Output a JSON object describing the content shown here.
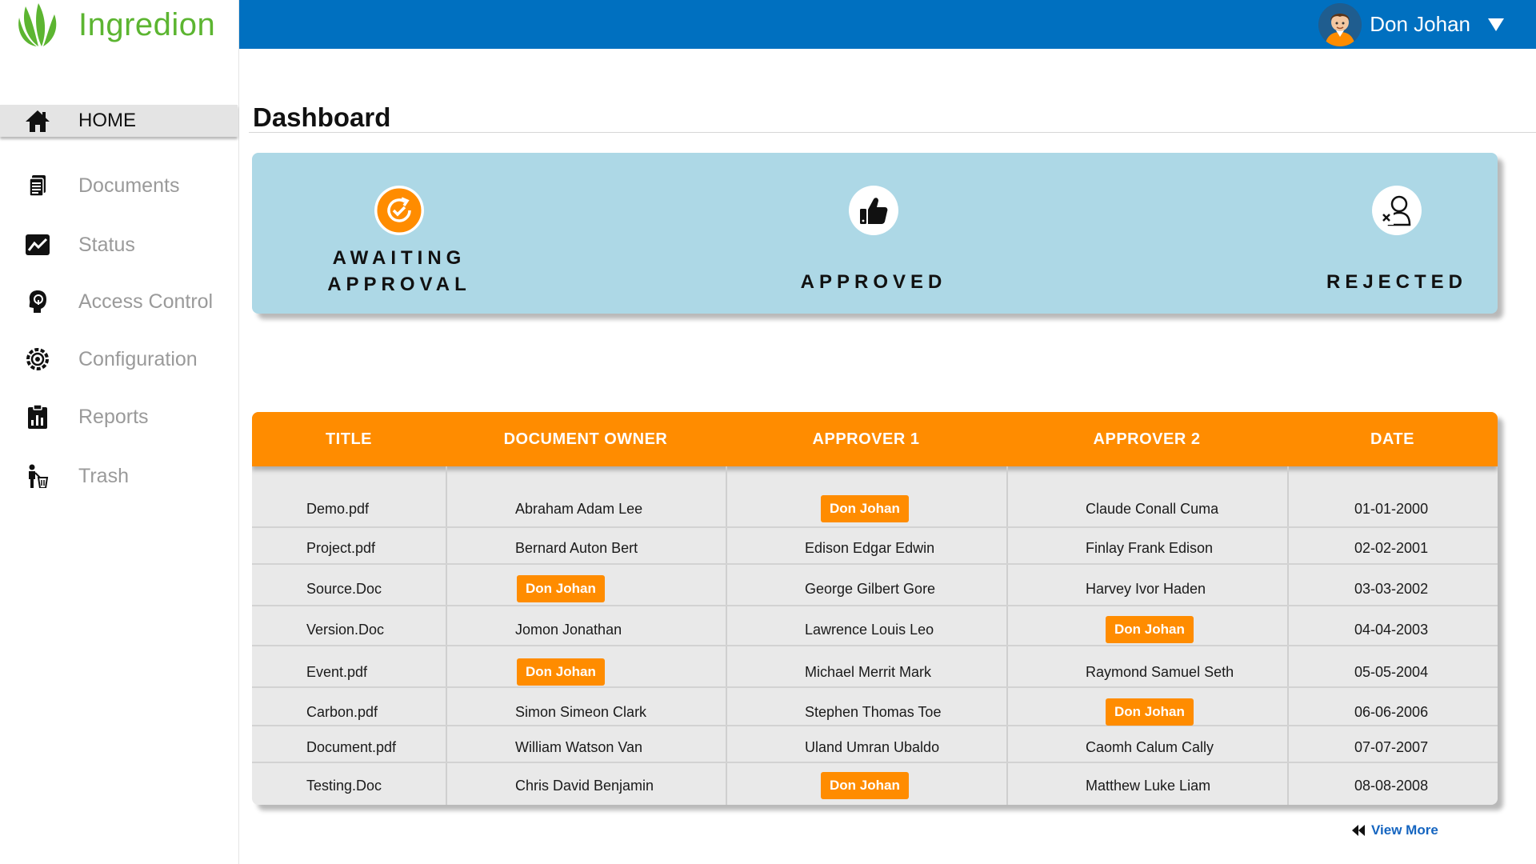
{
  "brand": {
    "name": "Ingredion",
    "color": "#5cb531"
  },
  "sidebar": {
    "items": [
      {
        "label": "HOME",
        "icon": "home-icon",
        "active": true
      },
      {
        "label": "Documents",
        "icon": "documents-icon",
        "active": false
      },
      {
        "label": "Status",
        "icon": "status-chart-icon",
        "active": false
      },
      {
        "label": "Access Control",
        "icon": "access-control-icon",
        "active": false
      },
      {
        "label": "Configuration",
        "icon": "configuration-gear-icon",
        "active": false
      },
      {
        "label": "Reports",
        "icon": "reports-icon",
        "active": false
      },
      {
        "label": "Trash",
        "icon": "trash-icon",
        "active": false
      }
    ]
  },
  "header": {
    "user_name": "Don Johan",
    "bar_color": "#0070c0"
  },
  "page": {
    "title": "Dashboard"
  },
  "status_panel": {
    "awaiting": "AWAITING\nAPPROVAL",
    "approved": "APPROVED",
    "rejected": "REJECTED",
    "background": "#add8e6",
    "accent": "#ff8c00"
  },
  "table": {
    "columns": [
      "TITLE",
      "DOCUMENT OWNER",
      "APPROVER 1",
      "APPROVER 2",
      "DATE"
    ],
    "rows": [
      [
        "Demo.pdf",
        "Abraham Adam Lee",
        "Don Johan",
        "Claude Conall Cuma",
        "01-01-2000"
      ],
      [
        "Project.pdf",
        "Bernard Auton Bert",
        "Edison Edgar Edwin",
        "Finlay Frank Edison",
        "02-02-2001"
      ],
      [
        "Source.Doc",
        "Don Johan",
        "George Gilbert Gore",
        "Harvey Ivor Haden",
        "03-03-2002"
      ],
      [
        "Version.Doc",
        "Jomon Jonathan",
        "Lawrence Louis Leo",
        "Don Johan",
        "04-04-2003"
      ],
      [
        "Event.pdf",
        "Don Johan",
        "Michael Merrit Mark",
        "Raymond Samuel Seth",
        "05-05-2004"
      ],
      [
        "Carbon.pdf",
        "Simon Simeon Clark",
        "Stephen Thomas Toe",
        "Don Johan",
        "06-06-2006"
      ],
      [
        "Document.pdf",
        "William Watson Van",
        "Uland Umran Ubaldo",
        "Caomh Calum Cally",
        "07-07-2007"
      ],
      [
        "Testing.Doc",
        "Chris David Benjamin",
        "Don Johan",
        "Matthew Luke Liam",
        "08-08-2008"
      ]
    ],
    "highlight_name": "Don Johan",
    "header_color": "#ff8c00"
  },
  "footer": {
    "view_more": "View More"
  }
}
